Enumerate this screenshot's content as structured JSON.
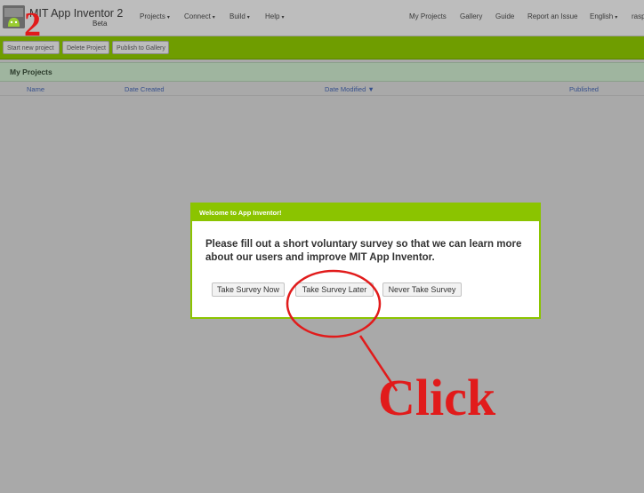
{
  "header": {
    "app_title": "MIT App Inventor 2",
    "app_subtitle": "Beta",
    "nav_left": [
      "Projects",
      "Connect",
      "Build",
      "Help"
    ],
    "nav_right": [
      "My Projects",
      "Gallery",
      "Guide",
      "Report an Issue",
      "English",
      "rasp"
    ]
  },
  "toolbar": {
    "start_label": "Start new project",
    "delete_label": "Delete Project",
    "publish_label": "Publish to Gallery"
  },
  "projects": {
    "title": "My Projects",
    "columns": [
      "Name",
      "Date Created",
      "Date Modified ▼",
      "Published"
    ]
  },
  "dialog": {
    "title": "Welcome to App Inventor!",
    "message": "Please fill out a short voluntary survey so that we can learn more about our users and improve MIT App Inventor.",
    "buttons": [
      "Take Survey Now",
      "Take Survey Later",
      "Never Take Survey"
    ]
  },
  "annotations": {
    "step_number": "2",
    "click_text": "Click",
    "color": "#e11b1b"
  },
  "colors": {
    "accent": "#8bc400",
    "toolbar": "#6f9d00"
  }
}
